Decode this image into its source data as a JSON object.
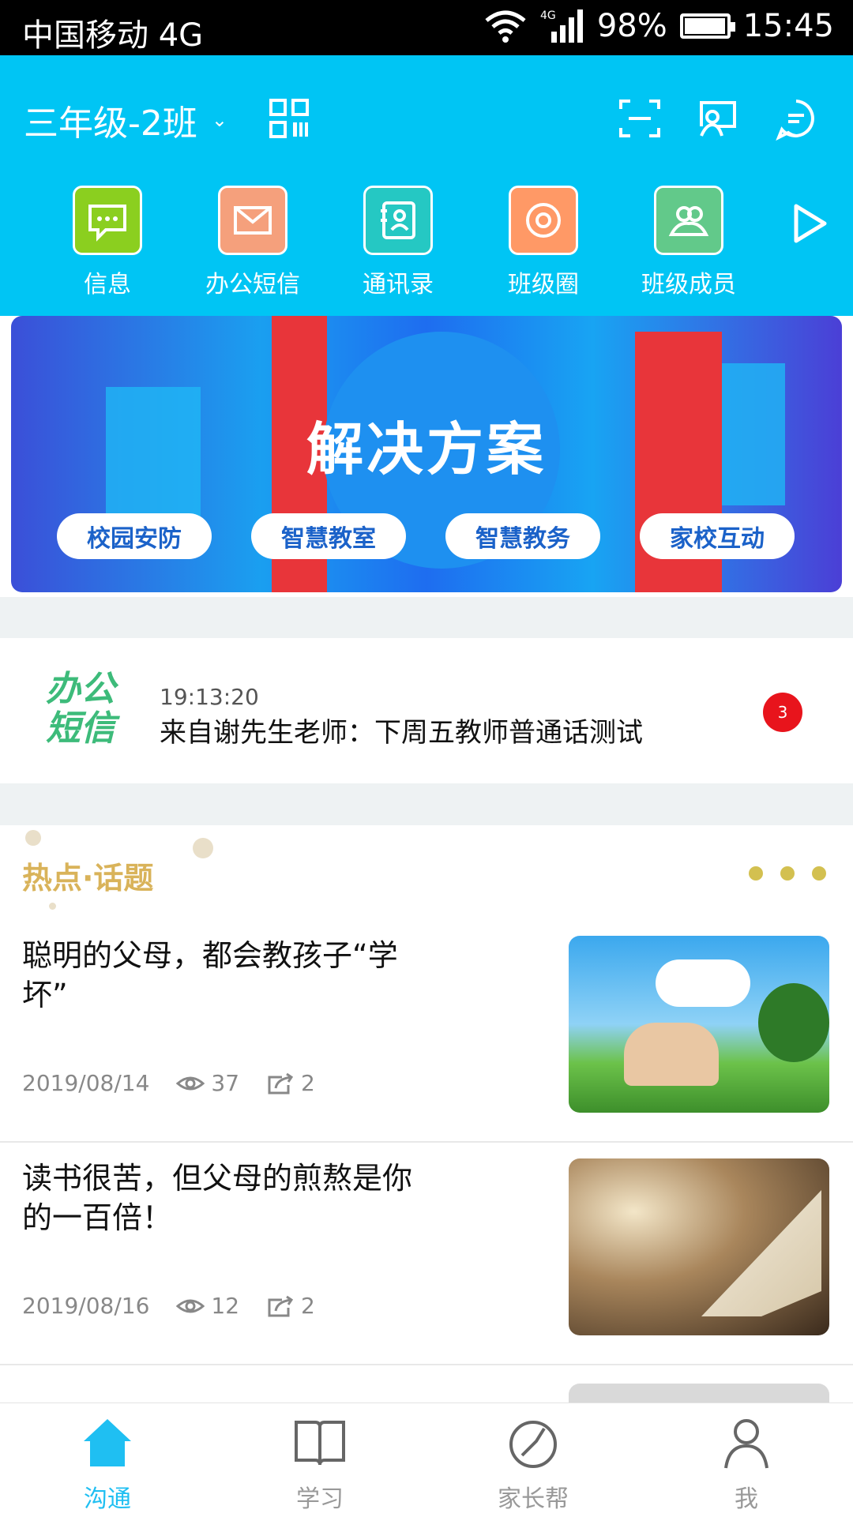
{
  "status_bar": {
    "carrier": "中国移动 4G",
    "battery": "98%",
    "battery_level": 0.98,
    "time": "15:45"
  },
  "header": {
    "class_name": "三年级-2班",
    "icons": [
      "qr-code-icon",
      "scan-icon",
      "screen-cast-icon",
      "chat-icon"
    ]
  },
  "quick_actions": [
    {
      "label": "信息",
      "icon": "message-icon",
      "color": "#8bcf1f"
    },
    {
      "label": "办公短信",
      "icon": "mail-icon",
      "color": "#f5a07c"
    },
    {
      "label": "通讯录",
      "icon": "contacts-icon",
      "color": "#25c8c3"
    },
    {
      "label": "班级圈",
      "icon": "circle-icon",
      "color": "#ff9966"
    },
    {
      "label": "班级成员",
      "icon": "members-icon",
      "color": "#62c98a"
    }
  ],
  "banner": {
    "title": "解决方案",
    "pills": [
      "校园安防",
      "智慧教室",
      "智慧教务",
      "家校互动"
    ]
  },
  "sms": {
    "logo": "办公短信",
    "time": "19:13:20",
    "text": "来自谢先生老师：下周五教师普通话测试",
    "badge": "3"
  },
  "hot_topics": {
    "title": "热点·话题",
    "articles": [
      {
        "title": "聪明的父母，都会教孩子“学坏”",
        "date": "2019/08/14",
        "views": "37",
        "shares": "2"
      },
      {
        "title": "读书很苦，但父母的煎熬是你的一百倍！",
        "date": "2019/08/16",
        "views": "12",
        "shares": "2"
      }
    ]
  },
  "tabs": [
    {
      "label": "沟通",
      "icon": "home-icon",
      "active": true
    },
    {
      "label": "学习",
      "icon": "book-icon",
      "active": false
    },
    {
      "label": "家长帮",
      "icon": "compass-icon",
      "active": false
    },
    {
      "label": "我",
      "icon": "user-icon",
      "active": false
    }
  ],
  "colors": {
    "header_bg": "#00c5f4",
    "accent": "#1fbff2",
    "hot_title": "#d9b35a",
    "badge": "#e8141c"
  }
}
